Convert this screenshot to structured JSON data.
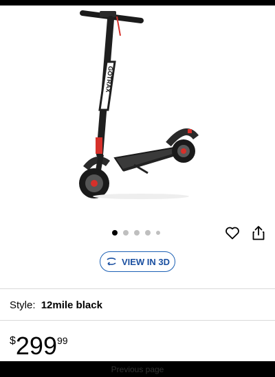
{
  "product": {
    "image_alt": "electric scooter",
    "brand_text": "GOTRAX"
  },
  "carousel": {
    "dots": 5,
    "active_index": 0,
    "favorite_icon": "heart-icon",
    "share_icon": "share-icon"
  },
  "view3d": {
    "label": "VIEW IN 3D",
    "icon": "rotate-3d-icon"
  },
  "style": {
    "label": "Style:",
    "value": "12mile black"
  },
  "price": {
    "currency": "$",
    "dollars": "299",
    "cents": "99"
  },
  "bottom_bar": {
    "label": "Previous page"
  },
  "colors": {
    "accent": "#1a5fb4",
    "scooter_red": "#d6302a"
  }
}
